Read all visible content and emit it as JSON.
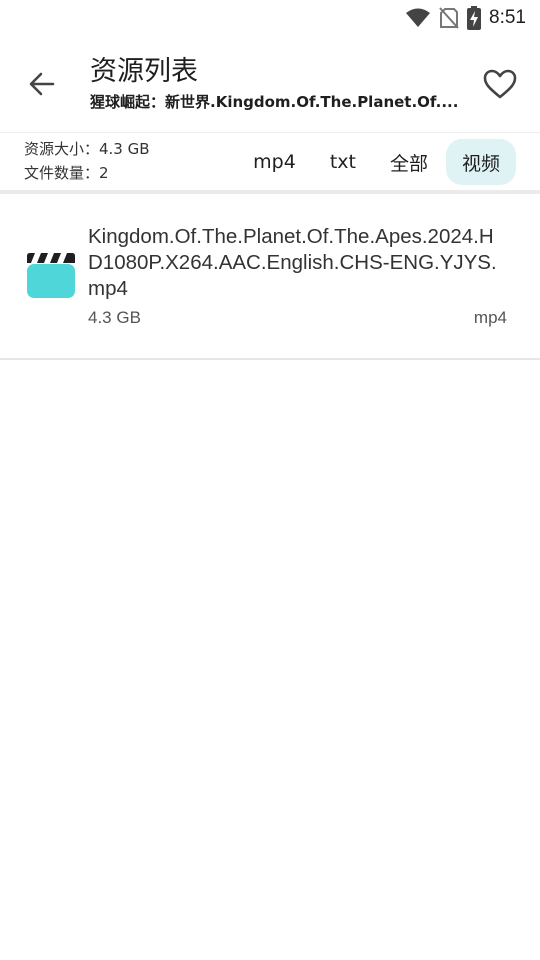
{
  "status_bar": {
    "time": "8:51",
    "icons": [
      "wifi-icon",
      "no-sim-icon",
      "battery-charging-icon"
    ]
  },
  "header": {
    "title": "资源列表",
    "subtitle": "猩球崛起：新世界.Kingdom.Of.The.Planet.Of....",
    "back_icon": "arrow-back-icon",
    "favorite_icon": "heart-outline-icon"
  },
  "summary": {
    "size_text": "资源大小：4.3 GB",
    "count_text": "文件数量：2"
  },
  "filters": [
    {
      "label": "mp4",
      "active": false
    },
    {
      "label": "txt",
      "active": false
    },
    {
      "label": "全部",
      "active": false
    },
    {
      "label": "视频",
      "active": true
    }
  ],
  "files": [
    {
      "name": "Kingdom.Of.The.Planet.Of.The.Apes.2024.HD1080P.X264.AAC.English.CHS-ENG.YJYS.mp4",
      "size": "4.3 GB",
      "type": "mp4",
      "icon": "video-clapperboard-icon"
    }
  ],
  "colors": {
    "accent_chip_bg": "#dff3f4",
    "video_icon": "#4fd6d8"
  }
}
